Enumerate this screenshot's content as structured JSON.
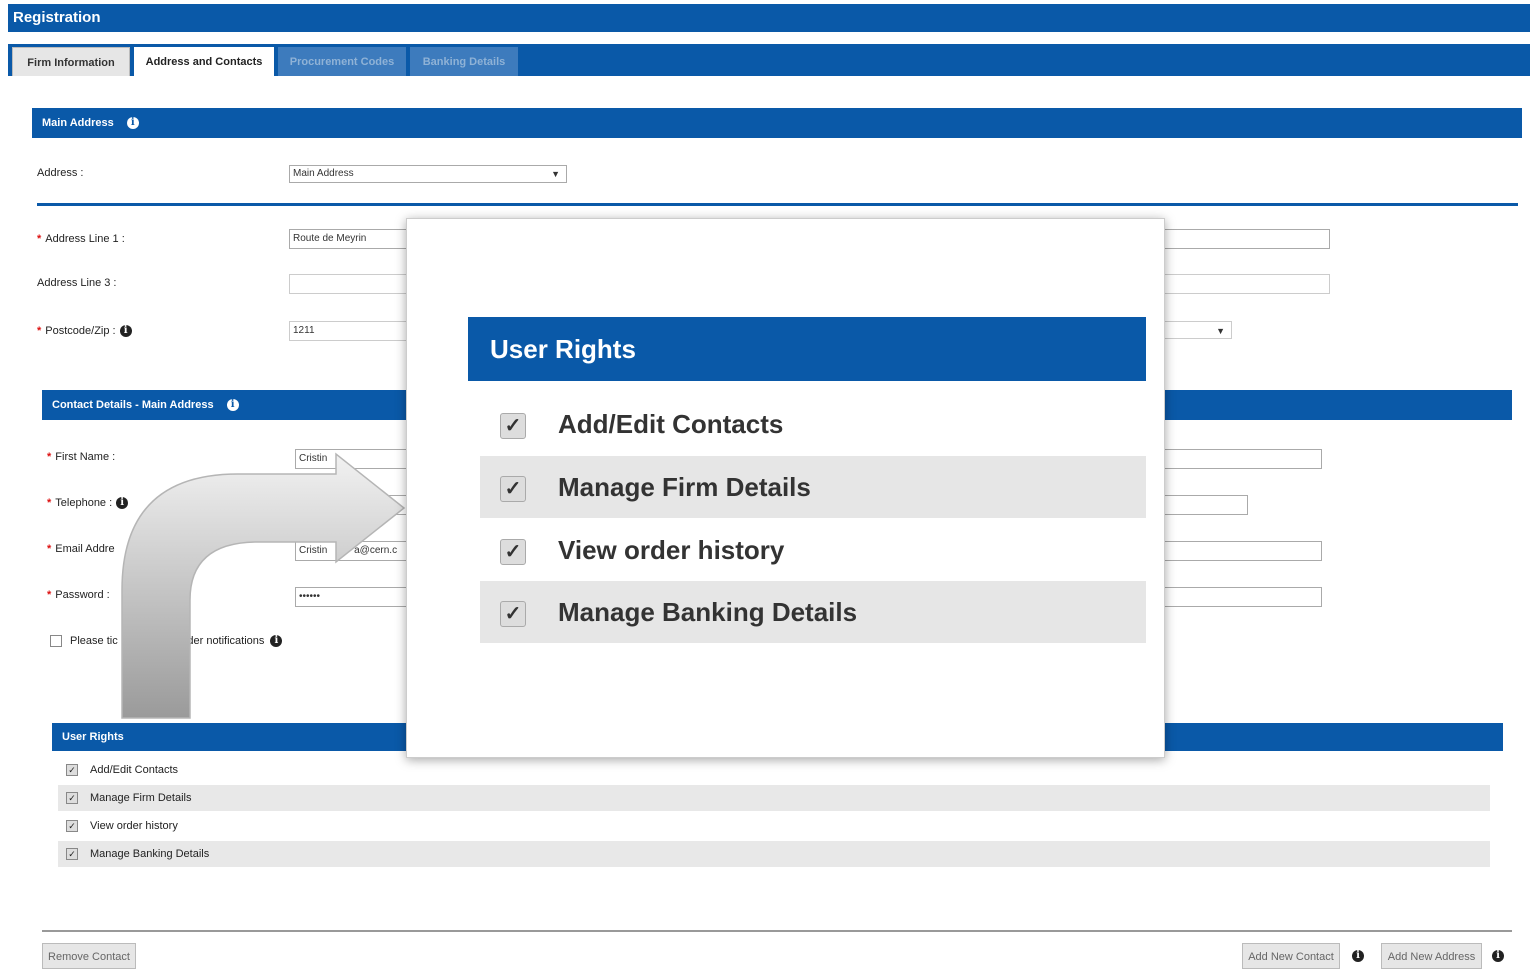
{
  "title": "Registration",
  "tabs": [
    {
      "label": "Firm Information"
    },
    {
      "label": "Address and Contacts"
    },
    {
      "label": "Procurement Codes"
    },
    {
      "label": "Banking Details"
    }
  ],
  "main_address": {
    "heading": "Main Address",
    "address_label": "Address :",
    "address_select_value": "Main Address",
    "line1_label": "Address Line 1 :",
    "line1_value": "Route de Meyrin",
    "line3_label": "Address Line 3 :",
    "line3_value": "",
    "postcode_label": "Postcode/Zip :",
    "postcode_value": "1211"
  },
  "contact": {
    "heading": "Contact Details - Main Address",
    "first_name_label": "First Name :",
    "first_name_value": "Cristin",
    "telephone_label": "Telephone :",
    "email_label": "Email Addre",
    "email_value": "Cristin",
    "email_value_tail": "a@cern.c",
    "password_label": "Password :",
    "password_value": "••••••",
    "notifications_label": "Please tic",
    "notifications_label_tail": "rder notifications"
  },
  "user_rights": {
    "heading": "User Rights",
    "items": [
      {
        "label": "Add/Edit Contacts",
        "checked": true
      },
      {
        "label": "Manage Firm Details",
        "checked": true
      },
      {
        "label": "View order history",
        "checked": true
      },
      {
        "label": "Manage Banking Details",
        "checked": true
      }
    ]
  },
  "popup": {
    "heading": "User Rights",
    "items": [
      {
        "label": "Add/Edit Contacts",
        "checked": true
      },
      {
        "label": "Manage Firm Details",
        "checked": true
      },
      {
        "label": "View order history",
        "checked": true
      },
      {
        "label": "Manage Banking Details",
        "checked": true
      }
    ]
  },
  "buttons": {
    "remove_contact": "Remove Contact",
    "add_new_contact": "Add New Contact",
    "add_new_address": "Add New Address"
  },
  "icons": {
    "info": "info-icon",
    "check": "checkmark-icon",
    "arrow": "curved-arrow-icon"
  },
  "colors": {
    "brand_blue": "#0a59a8",
    "required_red": "#dd1111"
  }
}
